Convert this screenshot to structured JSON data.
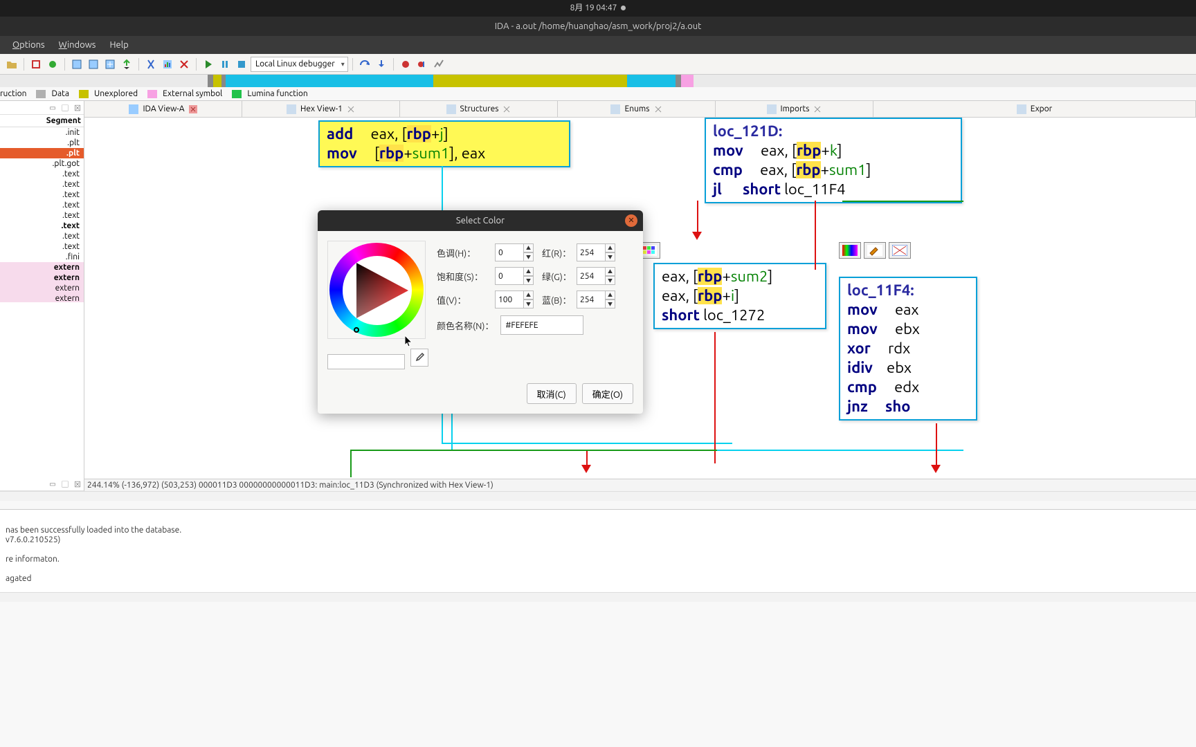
{
  "system_time": "8月 19  04:47",
  "window_title": "IDA - a.out /home/huanghao/asm_work/proj2/a.out",
  "menus": {
    "options": "Options",
    "windows": "Windows",
    "help": "Help"
  },
  "debugger_select": "Local Linux debugger",
  "legend": {
    "instruction": "ruction",
    "data": "Data",
    "unexplored": "Unexplored",
    "external": "External symbol",
    "lumina": "Lumina function"
  },
  "side": {
    "hdr": "Segment",
    "items": [
      {
        "t": ".init",
        "cls": ""
      },
      {
        "t": ".plt",
        "cls": ""
      },
      {
        "t": ".plt",
        "cls": "sel bold"
      },
      {
        "t": ".plt.got",
        "cls": ""
      },
      {
        "t": ".text",
        "cls": ""
      },
      {
        "t": ".text",
        "cls": ""
      },
      {
        "t": ".text",
        "cls": ""
      },
      {
        "t": ".text",
        "cls": ""
      },
      {
        "t": ".text",
        "cls": ""
      },
      {
        "t": ".text",
        "cls": "bold"
      },
      {
        "t": ".text",
        "cls": ""
      },
      {
        "t": ".text",
        "cls": ""
      },
      {
        "t": ".fini",
        "cls": ""
      },
      {
        "t": "extern",
        "cls": "pink bold"
      },
      {
        "t": "extern",
        "cls": "pink bold"
      },
      {
        "t": "extern",
        "cls": "pink"
      },
      {
        "t": "extern",
        "cls": "pink"
      }
    ]
  },
  "tabs": {
    "ida_view": "IDA View-A",
    "hex_view": "Hex View-1",
    "structures": "Structures",
    "enums": "Enums",
    "imports": "Imports",
    "exports": "Expor"
  },
  "asm": {
    "yellow": [
      "add     eax, [rbp+j]",
      "mov     [rbp+sum1], eax"
    ],
    "block_top_right": {
      "label": "loc_121D:",
      "lines": [
        "mov     eax, [rbp+k]",
        "cmp     eax, [rbp+sum1]",
        "jl      short loc_11F4"
      ]
    },
    "block_mid_right": [
      "eax, [rbp+sum2]",
      "eax, [rbp+i]",
      "short loc_1272"
    ],
    "block_far_right": {
      "label": "loc_11F4:",
      "lines": [
        "mov     eax",
        "mov     ebx",
        "xor     rdx",
        "idiv    ebx",
        "cmp     edx",
        "jnz     sho"
      ]
    }
  },
  "status_line": "244.14% (-136,972) (503,253) 000011D3 00000000000011D3: main:loc_11D3 (Synchronized with Hex View-1)",
  "output": {
    "l1": "nas been successfully loaded into the database.",
    "l2": "v7.6.0.210525)",
    "l3": "re informaton.",
    "l4": "agated"
  },
  "dialog": {
    "title": "Select Color",
    "hue_label": "色调(H)：",
    "sat_label": "饱和度(S)：",
    "val_label": "值(V)：",
    "red_label": "红(R)：",
    "green_label": "绿(G)：",
    "blue_label": "蓝(B)：",
    "name_label": "颜色名称(N)：",
    "hue": "0",
    "sat": "0",
    "val": "100",
    "red": "254",
    "green": "254",
    "blue": "254",
    "hex": "#FEFEFE",
    "cancel": "取消(C)",
    "ok": "确定(O)"
  }
}
